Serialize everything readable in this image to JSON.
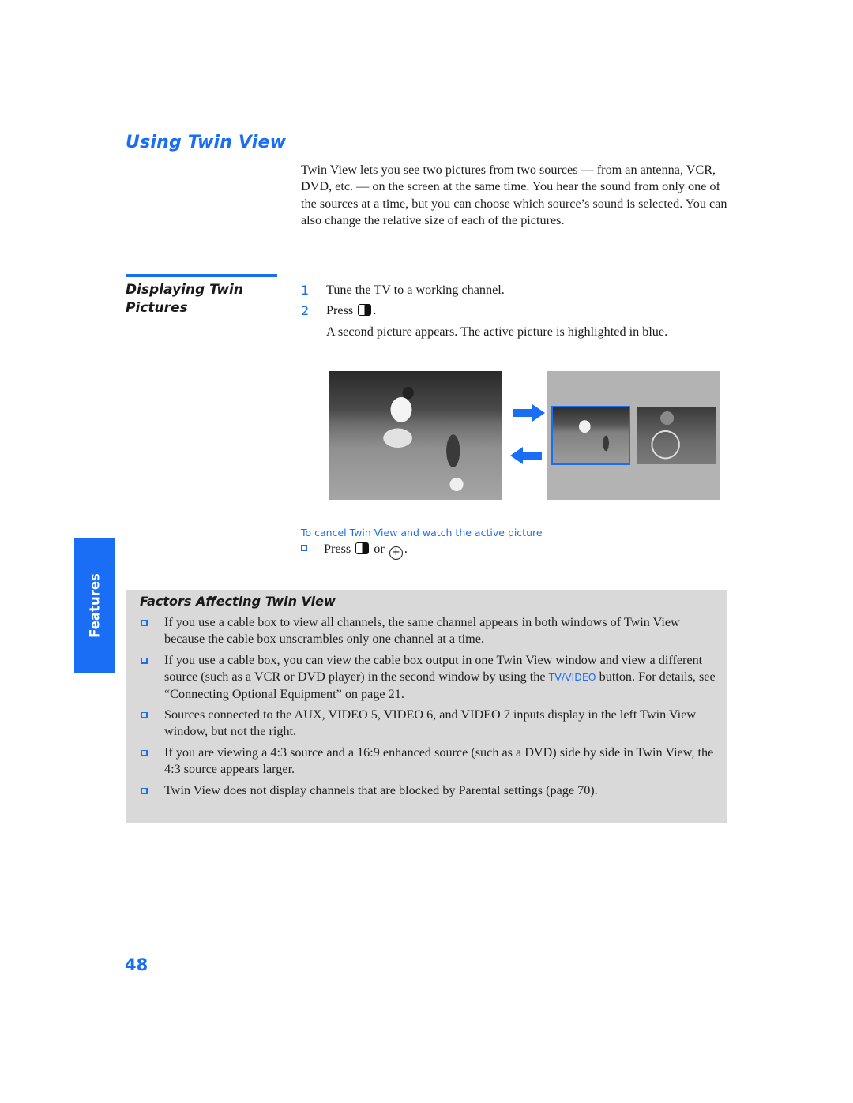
{
  "page": {
    "title": "Using Twin View",
    "intro": "Twin View lets you see two pictures from two sources — from an antenna, VCR, DVD, etc. — on the screen at the same time. You hear the sound from only one of the sources at a time, but you can choose which source’s sound is selected. You can also change the relative size of each of the pictures.",
    "page_number": "48",
    "side_tab": "Features",
    "accent_color": "#1a6ef5"
  },
  "displaying": {
    "heading": "Displaying Twin Pictures",
    "steps": [
      {
        "num": "1",
        "text": "Tune the TV to a working channel."
      },
      {
        "num": "2",
        "text_before": "Press",
        "icon": "twin-view-button-icon",
        "text_after": "."
      }
    ],
    "step2_note": "A second picture appears. The active picture is highlighted in blue.",
    "figure": {
      "single_picture": "Full-screen single picture (football player with child)",
      "twin_left": "Active picture (highlighted in blue)",
      "twin_right": "Second picture (basketball hoop)",
      "arrow_right": "arrow-right-icon",
      "arrow_left": "arrow-left-icon"
    }
  },
  "cancel": {
    "heading": "To cancel Twin View and watch the active picture",
    "press": "Press",
    "or": "or",
    "period": ".",
    "icons": [
      "twin-view-button-icon",
      "jump-button-icon"
    ]
  },
  "factors": {
    "heading": "Factors Affecting Twin View",
    "items": [
      {
        "text": "If you use a cable box to view all channels, the same channel appears in both windows of Twin View because the cable box unscrambles only one channel at a time."
      },
      {
        "text_before": "If you use a cable box, you can view the cable box output in one Twin View window and view a different source (such as a VCR or DVD player) in the second window by using the",
        "button_label": "TV/VIDEO",
        "text_after": "button. For details, see “Connecting Optional Equipment” on page 21."
      },
      {
        "text": "Sources connected to the AUX, VIDEO 5, VIDEO 6, and VIDEO 7 inputs display in the left Twin View window, but not the right."
      },
      {
        "text": "If you are viewing a 4:3 source and a 16:9 enhanced source (such as a DVD) side by side in Twin View, the 4:3 source appears larger."
      },
      {
        "text": "Twin View does not display channels that are blocked by Parental settings (page 70)."
      }
    ]
  }
}
